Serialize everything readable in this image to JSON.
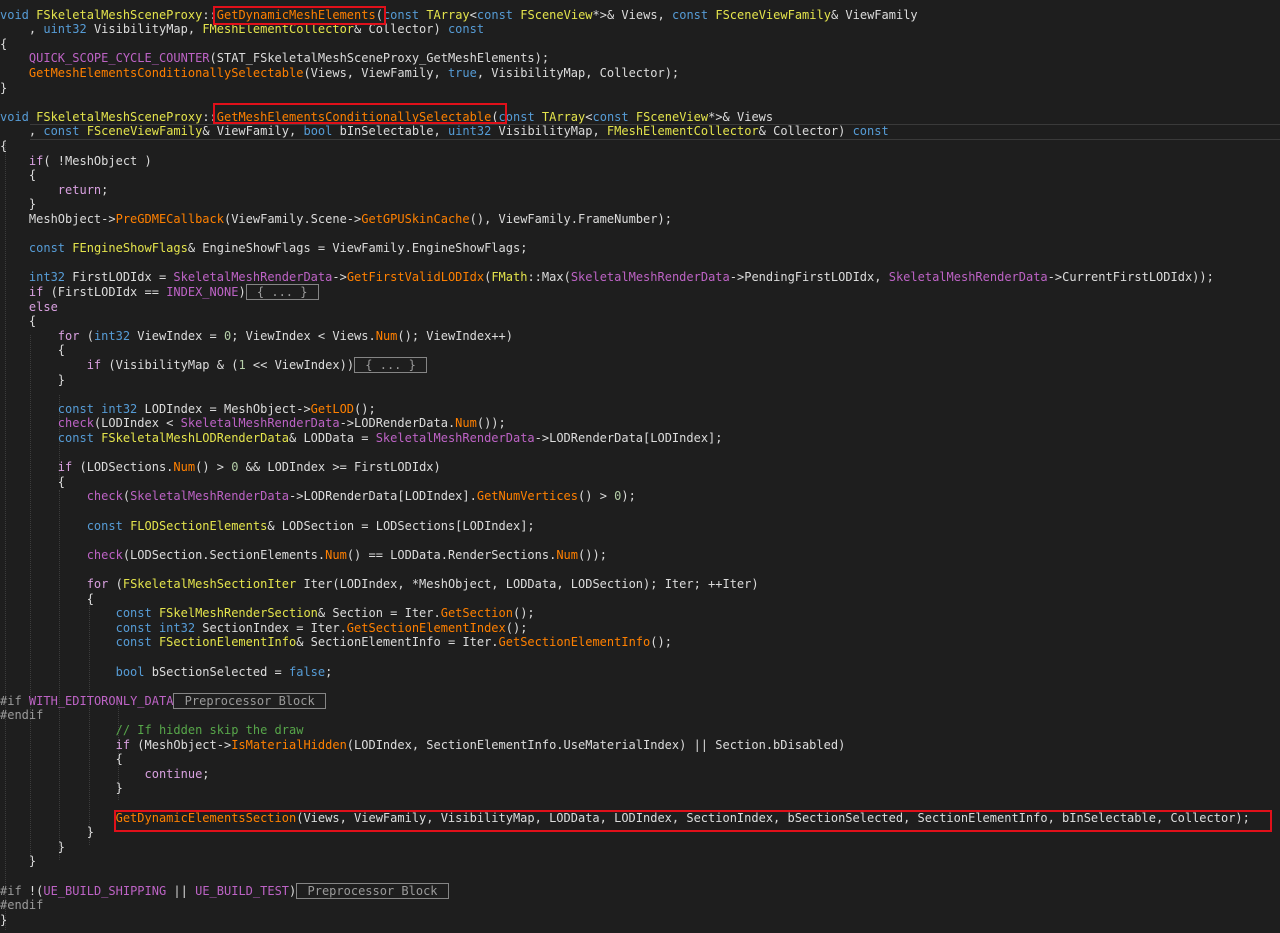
{
  "editor": {
    "background": "#1e1e1e",
    "token_colors": {
      "kw": "#569cd6",
      "ctl": "#d8a0df",
      "type": "#4ec9b0",
      "fn": "#ff8000",
      "var": "#bd63c5",
      "macro": "#bd63c5",
      "plain": "#dcdcdc",
      "num": "#b5cea8",
      "cmt": "#57a64a",
      "pp": "#9b9b9b",
      "cls": "#e4e44c"
    },
    "highlight_color": "#e0101a",
    "lines": [
      [
        [
          "kw",
          "void"
        ],
        [
          "plain",
          " "
        ],
        [
          "cls",
          "FSkeletalMeshSceneProxy"
        ],
        [
          "plain",
          "::"
        ],
        [
          "fn",
          "GetDynamicMeshElements"
        ],
        [
          "plain",
          "("
        ],
        [
          "kw",
          "const"
        ],
        [
          "plain",
          " "
        ],
        [
          "cls",
          "TArray"
        ],
        [
          "plain",
          "<"
        ],
        [
          "kw",
          "const"
        ],
        [
          "plain",
          " "
        ],
        [
          "cls",
          "FSceneView"
        ],
        [
          "plain",
          "*>& Views, "
        ],
        [
          "kw",
          "const"
        ],
        [
          "plain",
          " "
        ],
        [
          "cls",
          "FSceneViewFamily"
        ],
        [
          "plain",
          "& ViewFamily"
        ]
      ],
      [
        [
          "plain",
          "    , "
        ],
        [
          "kw",
          "uint32"
        ],
        [
          "plain",
          " VisibilityMap, "
        ],
        [
          "cls",
          "FMeshElementCollector"
        ],
        [
          "plain",
          "& Collector) "
        ],
        [
          "kw",
          "const"
        ]
      ],
      [
        [
          "plain",
          "{"
        ]
      ],
      [
        [
          "plain",
          "    "
        ],
        [
          "macro",
          "QUICK_SCOPE_CYCLE_COUNTER"
        ],
        [
          "plain",
          "(STAT_FSkeletalMeshSceneProxy_GetMeshElements);"
        ]
      ],
      [
        [
          "plain",
          "    "
        ],
        [
          "fn",
          "GetMeshElementsConditionallySelectable"
        ],
        [
          "plain",
          "(Views, ViewFamily, "
        ],
        [
          "bool",
          "true"
        ],
        [
          "plain",
          ", VisibilityMap, Collector);"
        ]
      ],
      [
        [
          "plain",
          "}"
        ]
      ],
      [
        [
          "plain",
          ""
        ]
      ],
      [
        [
          "kw",
          "void"
        ],
        [
          "plain",
          " "
        ],
        [
          "cls",
          "FSkeletalMeshSceneProxy"
        ],
        [
          "plain",
          "::"
        ],
        [
          "fn",
          "GetMeshElementsConditionallySelectable"
        ],
        [
          "plain",
          "("
        ],
        [
          "kw",
          "const"
        ],
        [
          "plain",
          " "
        ],
        [
          "cls",
          "TArray"
        ],
        [
          "plain",
          "<"
        ],
        [
          "kw",
          "const"
        ],
        [
          "plain",
          " "
        ],
        [
          "cls",
          "FSceneView"
        ],
        [
          "plain",
          "*>& Views"
        ]
      ],
      [
        [
          "plain",
          "    , "
        ],
        [
          "kw",
          "const"
        ],
        [
          "plain",
          " "
        ],
        [
          "cls",
          "FSceneViewFamily"
        ],
        [
          "plain",
          "& ViewFamily, "
        ],
        [
          "kw",
          "bool"
        ],
        [
          "plain",
          " bInSelectable, "
        ],
        [
          "kw",
          "uint32"
        ],
        [
          "plain",
          " VisibilityMap, "
        ],
        [
          "cls",
          "FMeshElementCollector"
        ],
        [
          "plain",
          "& Collector) "
        ],
        [
          "kw",
          "const"
        ]
      ],
      [
        [
          "plain",
          "{"
        ]
      ],
      [
        [
          "plain",
          "    "
        ],
        [
          "ctl",
          "if"
        ],
        [
          "plain",
          "( !MeshObject )"
        ]
      ],
      [
        [
          "plain",
          "    {"
        ]
      ],
      [
        [
          "plain",
          "        "
        ],
        [
          "ctl",
          "return"
        ],
        [
          "plain",
          ";"
        ]
      ],
      [
        [
          "plain",
          "    }"
        ]
      ],
      [
        [
          "plain",
          "    MeshObject->"
        ],
        [
          "fn",
          "PreGDMECallback"
        ],
        [
          "plain",
          "(ViewFamily.Scene->"
        ],
        [
          "fn",
          "GetGPUSkinCache"
        ],
        [
          "plain",
          "(), ViewFamily.FrameNumber);"
        ]
      ],
      [
        [
          "plain",
          ""
        ]
      ],
      [
        [
          "plain",
          "    "
        ],
        [
          "kw",
          "const"
        ],
        [
          "plain",
          " "
        ],
        [
          "cls",
          "FEngineShowFlags"
        ],
        [
          "plain",
          "& EngineShowFlags = ViewFamily.EngineShowFlags;"
        ]
      ],
      [
        [
          "plain",
          ""
        ]
      ],
      [
        [
          "plain",
          "    "
        ],
        [
          "kw",
          "int32"
        ],
        [
          "plain",
          " FirstLODIdx = "
        ],
        [
          "var",
          "SkeletalMeshRenderData"
        ],
        [
          "plain",
          "->"
        ],
        [
          "fn",
          "GetFirstValidLODIdx"
        ],
        [
          "plain",
          "("
        ],
        [
          "cls",
          "FMath"
        ],
        [
          "plain",
          "::"
        ],
        [
          "plain",
          "Max("
        ],
        [
          "var",
          "SkeletalMeshRenderData"
        ],
        [
          "plain",
          "->PendingFirstLODIdx, "
        ],
        [
          "var",
          "SkeletalMeshRenderData"
        ],
        [
          "plain",
          "->CurrentFirstLODIdx));"
        ]
      ],
      [
        [
          "plain",
          "    "
        ],
        [
          "ctl",
          "if"
        ],
        [
          "plain",
          " (FirstLODIdx == "
        ],
        [
          "macro",
          "INDEX_NONE"
        ],
        [
          "plain",
          ")"
        ],
        [
          "collapsed",
          " { ... } "
        ]
      ],
      [
        [
          "plain",
          "    "
        ],
        [
          "ctl",
          "else"
        ]
      ],
      [
        [
          "plain",
          "    {"
        ]
      ],
      [
        [
          "plain",
          "        "
        ],
        [
          "ctl",
          "for"
        ],
        [
          "plain",
          " ("
        ],
        [
          "kw",
          "int32"
        ],
        [
          "plain",
          " ViewIndex = "
        ],
        [
          "num",
          "0"
        ],
        [
          "plain",
          "; ViewIndex < Views."
        ],
        [
          "fn",
          "Num"
        ],
        [
          "plain",
          "(); ViewIndex++)"
        ]
      ],
      [
        [
          "plain",
          "        {"
        ]
      ],
      [
        [
          "plain",
          "            "
        ],
        [
          "ctl",
          "if"
        ],
        [
          "plain",
          " (VisibilityMap & ("
        ],
        [
          "num",
          "1"
        ],
        [
          "plain",
          " << ViewIndex))"
        ],
        [
          "collapsed",
          " { ... } "
        ]
      ],
      [
        [
          "plain",
          "        }"
        ]
      ],
      [
        [
          "plain",
          ""
        ]
      ],
      [
        [
          "plain",
          "        "
        ],
        [
          "kw",
          "const"
        ],
        [
          "plain",
          " "
        ],
        [
          "kw",
          "int32"
        ],
        [
          "plain",
          " LODIndex = MeshObject->"
        ],
        [
          "fn",
          "GetLOD"
        ],
        [
          "plain",
          "();"
        ]
      ],
      [
        [
          "plain",
          "        "
        ],
        [
          "macro",
          "check"
        ],
        [
          "plain",
          "(LODIndex < "
        ],
        [
          "var",
          "SkeletalMeshRenderData"
        ],
        [
          "plain",
          "->LODRenderData."
        ],
        [
          "fn",
          "Num"
        ],
        [
          "plain",
          "());"
        ]
      ],
      [
        [
          "plain",
          "        "
        ],
        [
          "kw",
          "const"
        ],
        [
          "plain",
          " "
        ],
        [
          "cls",
          "FSkeletalMeshLODRenderData"
        ],
        [
          "plain",
          "& LODData = "
        ],
        [
          "var",
          "SkeletalMeshRenderData"
        ],
        [
          "plain",
          "->LODRenderData[LODIndex];"
        ]
      ],
      [
        [
          "plain",
          ""
        ]
      ],
      [
        [
          "plain",
          "        "
        ],
        [
          "ctl",
          "if"
        ],
        [
          "plain",
          " (LODSections."
        ],
        [
          "fn",
          "Num"
        ],
        [
          "plain",
          "() > "
        ],
        [
          "num",
          "0"
        ],
        [
          "plain",
          " && LODIndex >= FirstLODIdx)"
        ]
      ],
      [
        [
          "plain",
          "        {"
        ]
      ],
      [
        [
          "plain",
          "            "
        ],
        [
          "macro",
          "check"
        ],
        [
          "plain",
          "("
        ],
        [
          "var",
          "SkeletalMeshRenderData"
        ],
        [
          "plain",
          "->LODRenderData[LODIndex]."
        ],
        [
          "fn",
          "GetNumVertices"
        ],
        [
          "plain",
          "() > "
        ],
        [
          "num",
          "0"
        ],
        [
          "plain",
          ");"
        ]
      ],
      [
        [
          "plain",
          ""
        ]
      ],
      [
        [
          "plain",
          "            "
        ],
        [
          "kw",
          "const"
        ],
        [
          "plain",
          " "
        ],
        [
          "cls",
          "FLODSectionElements"
        ],
        [
          "plain",
          "& LODSection = LODSections[LODIndex];"
        ]
      ],
      [
        [
          "plain",
          ""
        ]
      ],
      [
        [
          "plain",
          "            "
        ],
        [
          "macro",
          "check"
        ],
        [
          "plain",
          "(LODSection.SectionElements."
        ],
        [
          "fn",
          "Num"
        ],
        [
          "plain",
          "() == LODData.RenderSections."
        ],
        [
          "fn",
          "Num"
        ],
        [
          "plain",
          "());"
        ]
      ],
      [
        [
          "plain",
          ""
        ]
      ],
      [
        [
          "plain",
          "            "
        ],
        [
          "ctl",
          "for"
        ],
        [
          "plain",
          " ("
        ],
        [
          "cls",
          "FSkeletalMeshSectionIter"
        ],
        [
          "plain",
          " Iter(LODIndex, *MeshObject, LODData, LODSection); Iter; ++Iter)"
        ]
      ],
      [
        [
          "plain",
          "            {"
        ]
      ],
      [
        [
          "plain",
          "                "
        ],
        [
          "kw",
          "const"
        ],
        [
          "plain",
          " "
        ],
        [
          "cls",
          "FSkelMeshRenderSection"
        ],
        [
          "plain",
          "& Section = Iter."
        ],
        [
          "fn",
          "GetSection"
        ],
        [
          "plain",
          "();"
        ]
      ],
      [
        [
          "plain",
          "                "
        ],
        [
          "kw",
          "const"
        ],
        [
          "plain",
          " "
        ],
        [
          "kw",
          "int32"
        ],
        [
          "plain",
          " SectionIndex = Iter."
        ],
        [
          "fn",
          "GetSectionElementIndex"
        ],
        [
          "plain",
          "();"
        ]
      ],
      [
        [
          "plain",
          "                "
        ],
        [
          "kw",
          "const"
        ],
        [
          "plain",
          " "
        ],
        [
          "cls",
          "FSectionElementInfo"
        ],
        [
          "plain",
          "& SectionElementInfo = Iter."
        ],
        [
          "fn",
          "GetSectionElementInfo"
        ],
        [
          "plain",
          "();"
        ]
      ],
      [
        [
          "plain",
          ""
        ]
      ],
      [
        [
          "plain",
          "                "
        ],
        [
          "kw",
          "bool"
        ],
        [
          "plain",
          " bSectionSelected = "
        ],
        [
          "bool",
          "false"
        ],
        [
          "plain",
          ";"
        ]
      ],
      [
        [
          "plain",
          ""
        ]
      ],
      [
        [
          "pp",
          "#if"
        ],
        [
          "plain",
          " "
        ],
        [
          "ppid",
          "WITH_EDITORONLY_DATA"
        ],
        [
          "collapsed",
          " Preprocessor Block "
        ]
      ],
      [
        [
          "pp",
          "#endif"
        ]
      ],
      [
        [
          "plain",
          "                "
        ],
        [
          "cmt",
          "// If hidden skip the draw"
        ]
      ],
      [
        [
          "plain",
          "                "
        ],
        [
          "ctl",
          "if"
        ],
        [
          "plain",
          " (MeshObject->"
        ],
        [
          "fn",
          "IsMaterialHidden"
        ],
        [
          "plain",
          "(LODIndex, SectionElementInfo.UseMaterialIndex) || Section.bDisabled)"
        ]
      ],
      [
        [
          "plain",
          "                {"
        ]
      ],
      [
        [
          "plain",
          "                    "
        ],
        [
          "ctl",
          "continue"
        ],
        [
          "plain",
          ";"
        ]
      ],
      [
        [
          "plain",
          "                }"
        ]
      ],
      [
        [
          "plain",
          ""
        ]
      ],
      [
        [
          "plain",
          "                "
        ],
        [
          "fn",
          "GetDynamicElementsSection"
        ],
        [
          "plain",
          "(Views, ViewFamily, VisibilityMap, LODData, LODIndex, SectionIndex, bSectionSelected, SectionElementInfo, bInSelectable, Collector);"
        ]
      ],
      [
        [
          "plain",
          "            }"
        ]
      ],
      [
        [
          "plain",
          "        }"
        ]
      ],
      [
        [
          "plain",
          "    }"
        ]
      ],
      [
        [
          "plain",
          ""
        ]
      ],
      [
        [
          "pp",
          "#if"
        ],
        [
          "plain",
          " !("
        ],
        [
          "ppid",
          "UE_BUILD_SHIPPING"
        ],
        [
          "plain",
          " || "
        ],
        [
          "ppid",
          "UE_BUILD_TEST"
        ],
        [
          "plain",
          ")"
        ],
        [
          "collapsed",
          " Preprocessor Block "
        ]
      ],
      [
        [
          "pp",
          "#endif"
        ]
      ],
      [
        [
          "plain",
          "}"
        ]
      ]
    ]
  }
}
